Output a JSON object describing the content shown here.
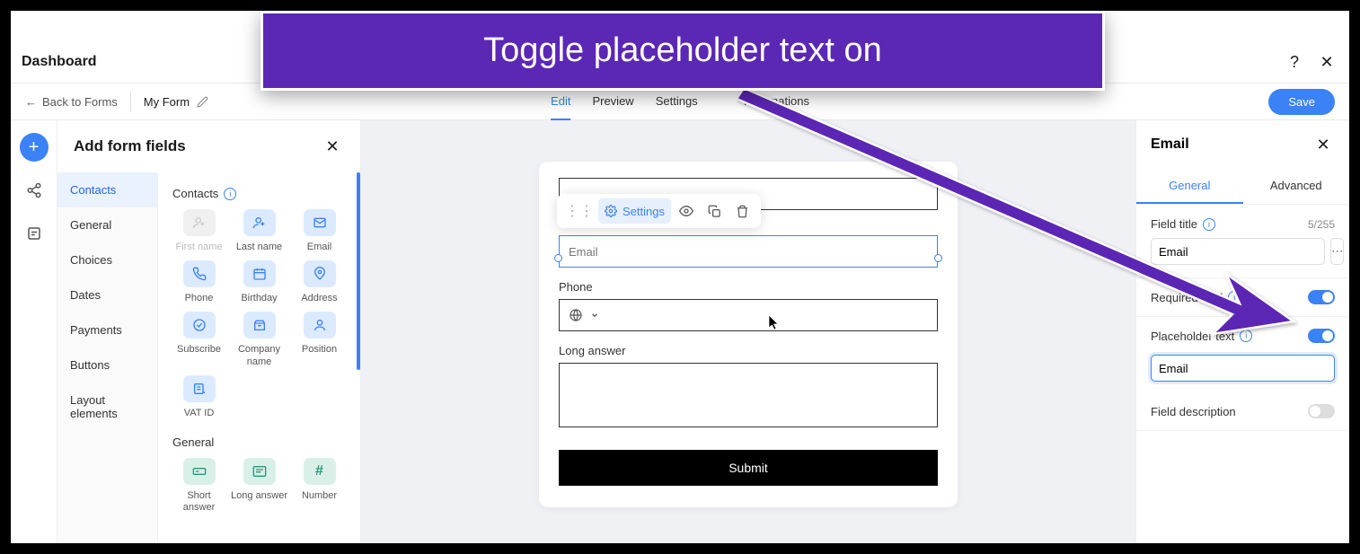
{
  "annotation": {
    "text": "Toggle placeholder text on"
  },
  "topbar": {
    "title": "Dashboard"
  },
  "subbar": {
    "back_label": "Back to Forms",
    "form_name": "My Form",
    "tabs": {
      "edit": "Edit",
      "preview": "Preview",
      "settings": "Settings",
      "automations": "Automations"
    },
    "save": "Save"
  },
  "leftpanel": {
    "title": "Add form fields",
    "categories": [
      "Contacts",
      "General",
      "Choices",
      "Dates",
      "Payments",
      "Buttons",
      "Layout elements"
    ],
    "sections": {
      "contacts": {
        "title": "Contacts",
        "items": [
          "First name",
          "Last name",
          "Email",
          "Phone",
          "Birthday",
          "Address",
          "Subscribe",
          "Company name",
          "Position",
          "VAT ID"
        ]
      },
      "general": {
        "title": "General",
        "items": [
          "Short answer",
          "Long answer",
          "Number"
        ]
      }
    }
  },
  "form": {
    "email_placeholder": "Email",
    "phone_label": "Phone",
    "long_label": "Long answer",
    "submit": "Submit",
    "toolbar": {
      "settings": "Settings"
    }
  },
  "rightpanel": {
    "title": "Email",
    "tabs": {
      "general": "General",
      "advanced": "Advanced"
    },
    "field_title_label": "Field title",
    "field_title_value": "Email",
    "field_title_count": "5/255",
    "required_label": "Required field",
    "placeholder_label": "Placeholder text",
    "placeholder_value": "Email",
    "description_label": "Field description"
  }
}
